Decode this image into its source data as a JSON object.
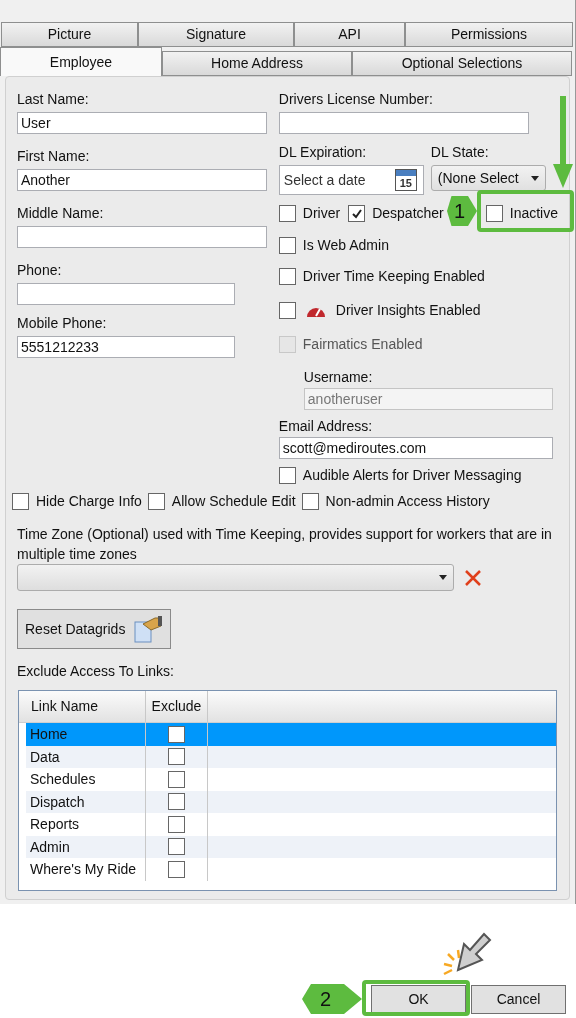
{
  "tabs": {
    "top_row": [
      {
        "label": "Picture",
        "selected": false
      },
      {
        "label": "Signature",
        "selected": false
      },
      {
        "label": "API",
        "selected": false
      },
      {
        "label": "Permissions",
        "selected": false
      }
    ],
    "bottom_row": [
      {
        "label": "Employee",
        "selected": true
      },
      {
        "label": "Home Address",
        "selected": false
      },
      {
        "label": "Optional Selections",
        "selected": false
      }
    ]
  },
  "left_fields": [
    {
      "label": "Last Name:",
      "value": "User",
      "kind": "wide"
    },
    {
      "label": "First Name:",
      "value": "Another",
      "kind": "wide"
    },
    {
      "label": "Middle Name:",
      "kind": "wide"
    },
    {
      "label": "Phone:",
      "kind": "short"
    },
    {
      "label": "Mobile Phone:",
      "value": "5551212233",
      "kind": "short"
    }
  ],
  "drivers_license": {
    "label": "Drivers License Number:"
  },
  "dl_expiration": {
    "label": "DL Expiration:",
    "placeholder": "Select a date",
    "calendar_day": "15"
  },
  "dl_state": {
    "label": "DL State:",
    "value": "(None Select"
  },
  "role_checkboxes": [
    {
      "label": "Driver",
      "checked": false
    },
    {
      "label": "Despatcher",
      "checked": true
    },
    {
      "label": "Inactive",
      "checked": false
    }
  ],
  "options": [
    {
      "label": "Is Web Admin",
      "checked": false,
      "disabled": false,
      "kind": "plain"
    },
    {
      "label": "Driver Time Keeping Enabled",
      "checked": false,
      "disabled": false,
      "kind": "plain"
    },
    {
      "label": "Driver Insights Enabled",
      "checked": false,
      "disabled": false,
      "kind": "gauge"
    },
    {
      "label": "Fairmatics Enabled",
      "checked": false,
      "disabled": true,
      "kind": "plain"
    }
  ],
  "username": {
    "label": "Username:",
    "value": "anotheruser",
    "disabled": true
  },
  "email": {
    "label": "Email Address:",
    "value": "scott@mediroutes.com"
  },
  "audible_alerts": {
    "label": "Audible Alerts for Driver Messaging",
    "checked": false
  },
  "access_checkboxes": [
    {
      "label": "Hide Charge Info",
      "checked": false
    },
    {
      "label": "Allow Schedule Edit",
      "checked": false
    },
    {
      "label": "Non-admin Access History",
      "checked": false
    }
  ],
  "time_zone": {
    "label": "Time Zone (Optional) used with Time Keeping, provides support for workers that are in multiple time zones"
  },
  "reset_button": "Reset Datagrids",
  "exclude_label": "Exclude Access To Links:",
  "table": {
    "columns": [
      "Link Name",
      "Exclude"
    ],
    "rows": [
      {
        "name": "Home",
        "exclude": false,
        "selected": true
      },
      {
        "name": "Data",
        "exclude": false,
        "selected": false
      },
      {
        "name": "Schedules",
        "exclude": false,
        "selected": false
      },
      {
        "name": "Dispatch",
        "exclude": false,
        "selected": false
      },
      {
        "name": "Reports",
        "exclude": false,
        "selected": false
      },
      {
        "name": "Admin",
        "exclude": false,
        "selected": false
      },
      {
        "name": "Where's My Ride",
        "exclude": false,
        "selected": false
      }
    ]
  },
  "buttons": [
    "OK",
    "Cancel"
  ],
  "annotations": [
    {
      "label": "1"
    },
    {
      "label": "2"
    }
  ]
}
